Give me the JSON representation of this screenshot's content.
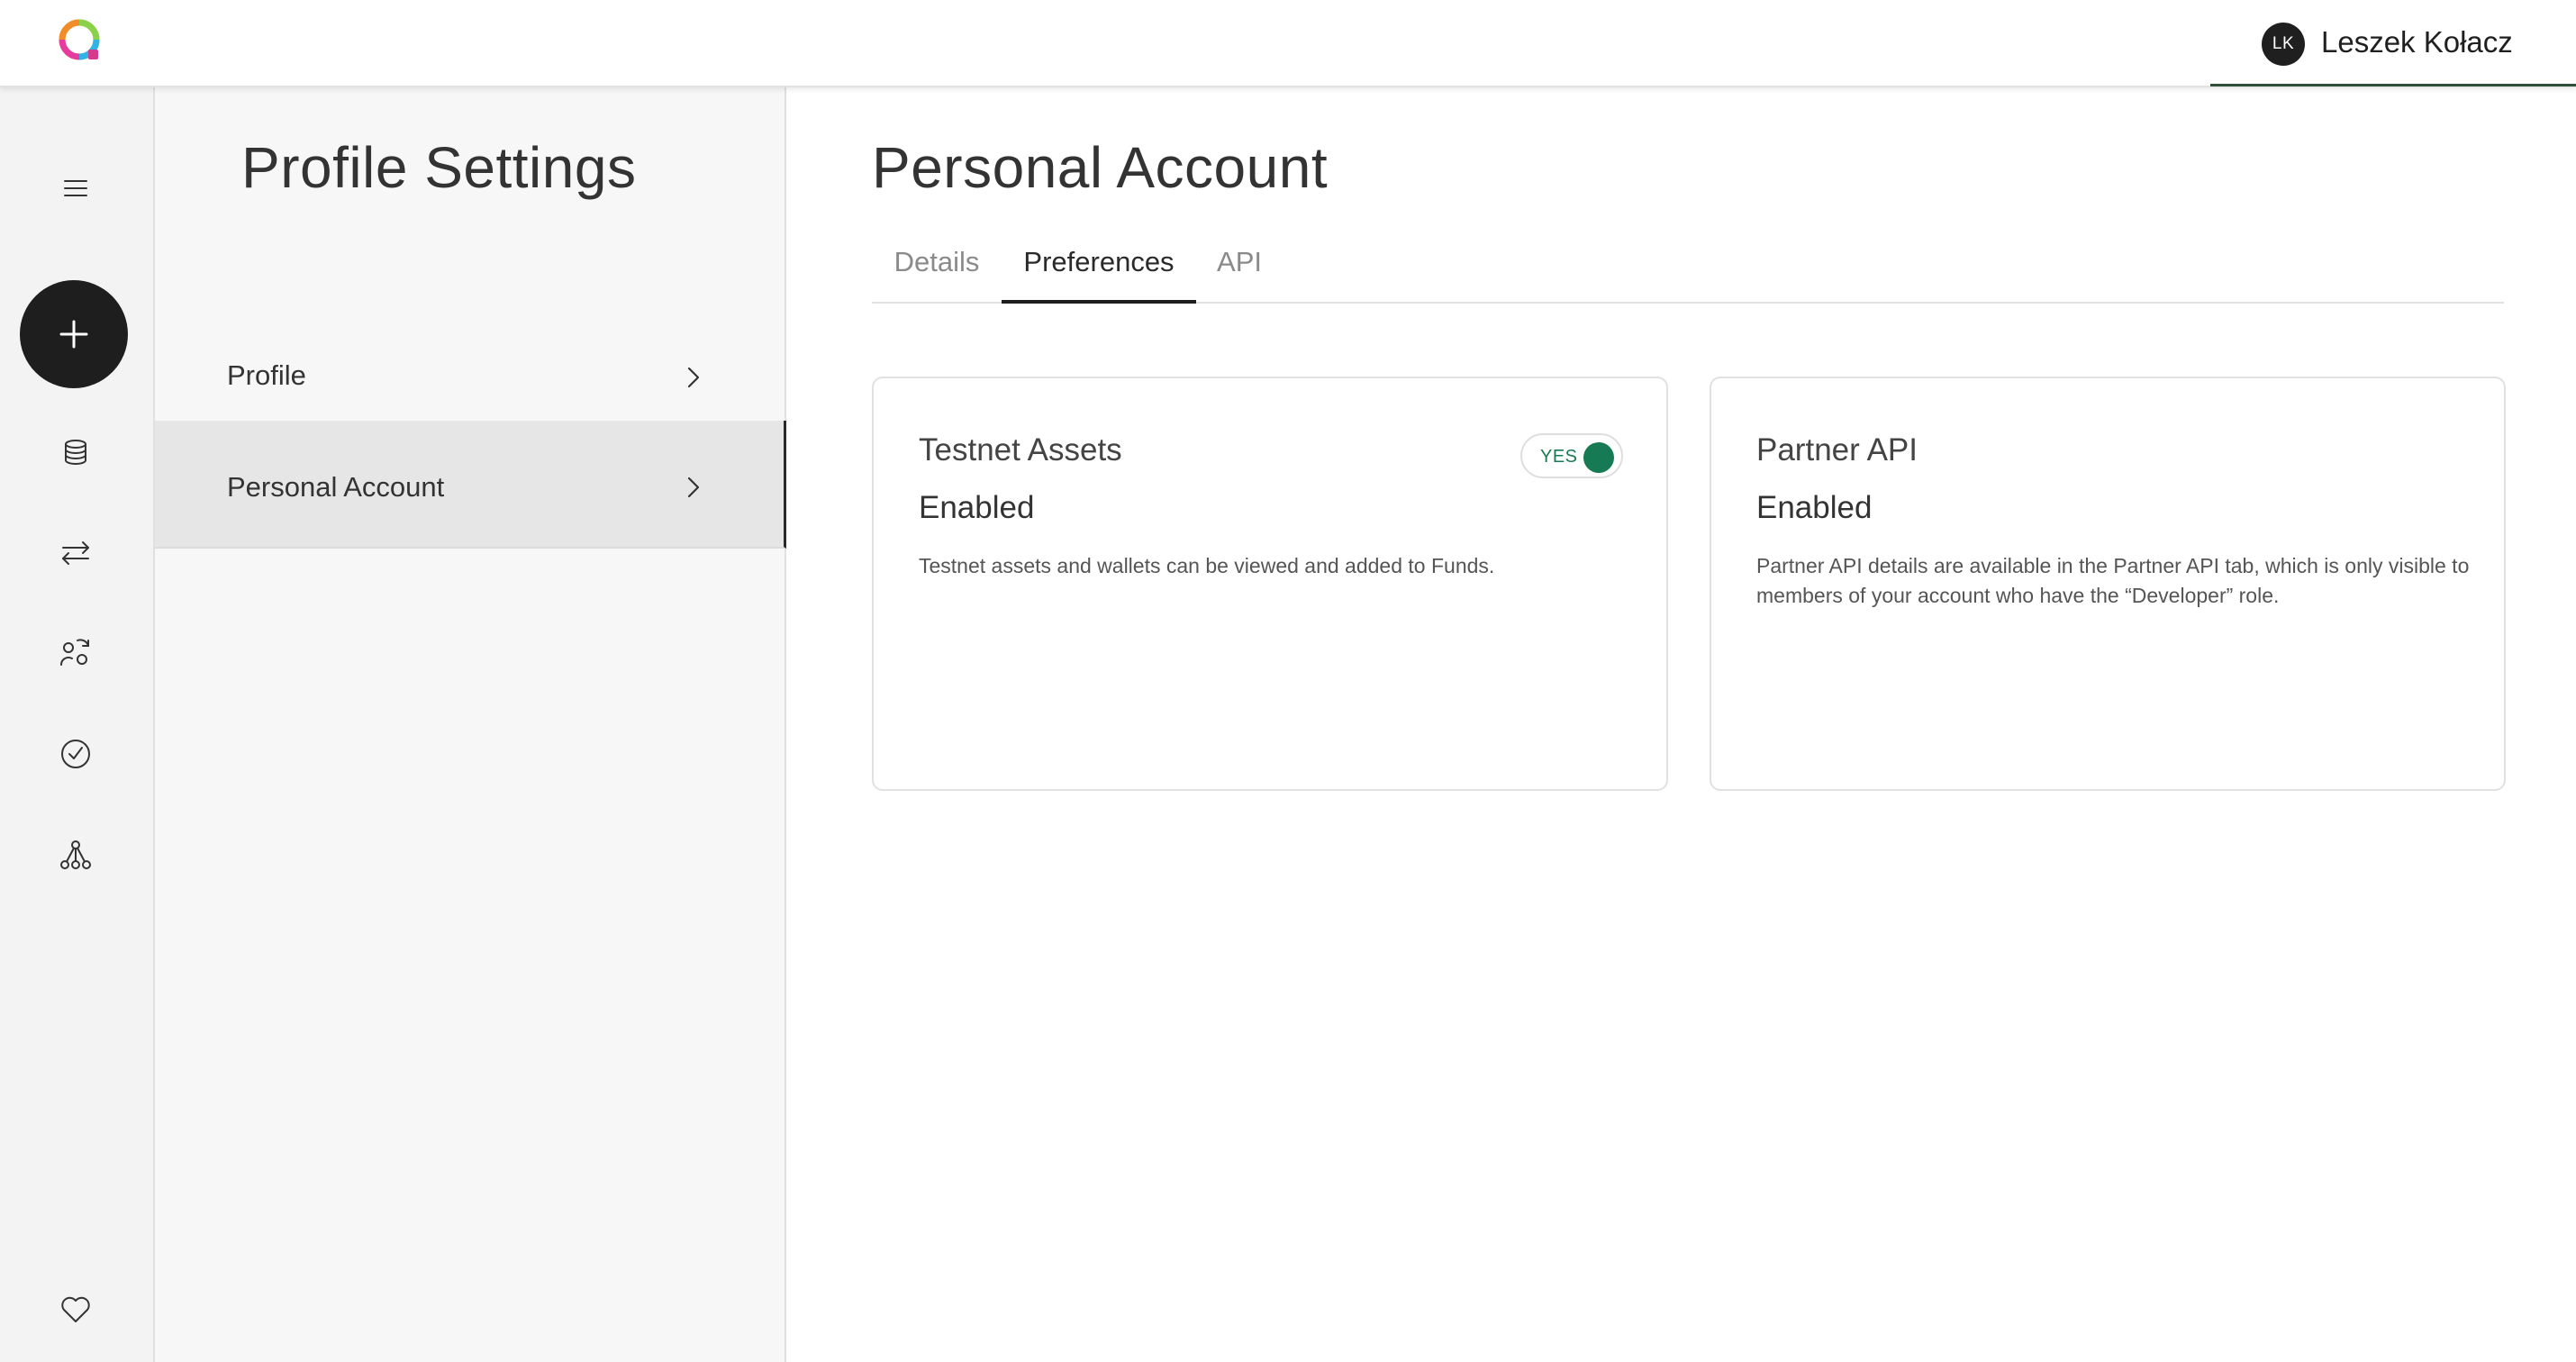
{
  "header": {
    "logo": "app-logo",
    "user_initials": "LK",
    "user_name": "Leszek Kołacz"
  },
  "rail": {
    "items": [
      "menu-icon",
      "add-icon",
      "database-icon",
      "transfer-arrows-icon",
      "swap-people-icon",
      "check-circle-icon",
      "network-nodes-icon",
      "heart-icon"
    ]
  },
  "settings": {
    "title": "Profile Settings",
    "items": [
      {
        "label": "Profile",
        "active": false
      },
      {
        "label": "Personal Account",
        "active": true
      }
    ]
  },
  "main": {
    "title": "Personal Account",
    "tabs": [
      {
        "label": "Details",
        "active": false
      },
      {
        "label": "Preferences",
        "active": true
      },
      {
        "label": "API",
        "active": false
      }
    ],
    "cards": [
      {
        "title": "Testnet Assets",
        "status": "Enabled",
        "description": "Testnet assets and wallets can be viewed and added to Funds.",
        "toggle": {
          "label": "YES",
          "on": true
        }
      },
      {
        "title": "Partner API",
        "status": "Enabled",
        "description": "Partner API details are available in the Partner API tab, which is only visible to members of your account who have the “Developer” role."
      }
    ]
  },
  "colors": {
    "accent_green": "#167a55",
    "dark": "#1e1e1e",
    "rail_bg": "#f3f3f3",
    "sidebar_bg": "#f7f7f7",
    "active_item_bg": "#e6e6e6"
  }
}
